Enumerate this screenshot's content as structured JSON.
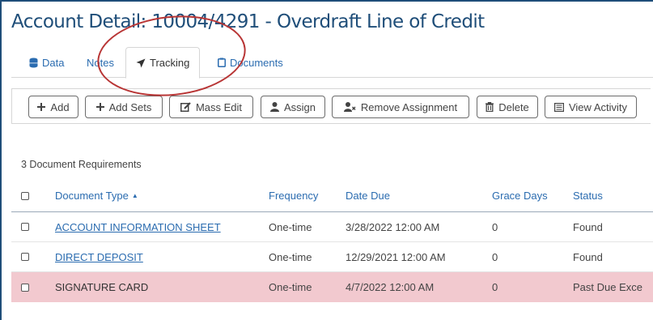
{
  "page": {
    "title": "Account Detail: 10004/4291 - Overdraft Line of Credit"
  },
  "tabs": [
    {
      "label": "Data",
      "icon": "database-icon"
    },
    {
      "label": "Notes",
      "icon": ""
    },
    {
      "label": "Tracking",
      "icon": "paper-plane-icon",
      "active": true
    },
    {
      "label": "Documents",
      "icon": "clipboard-icon"
    }
  ],
  "toolbar": {
    "buttons": [
      {
        "label": "Add",
        "icon": "plus-icon"
      },
      {
        "label": "Add Sets",
        "icon": "plus-icon"
      },
      {
        "label": "Mass Edit",
        "icon": "edit-icon"
      },
      {
        "label": "Assign",
        "icon": "user-icon"
      },
      {
        "label": "Remove Assignment",
        "icon": "user-remove-icon"
      },
      {
        "label": "Delete",
        "icon": "trash-icon"
      },
      {
        "label": "View Activity",
        "icon": "list-icon"
      }
    ]
  },
  "requirements": {
    "count_label": "3 Document Requirements",
    "columns": [
      "Document Type",
      "Frequency",
      "Date Due",
      "Grace Days",
      "Status"
    ],
    "sort_indicator": "▲",
    "rows": [
      {
        "document_type": "ACCOUNT INFORMATION SHEET",
        "frequency": "One-time",
        "date_due": "3/28/2022 12:00 AM",
        "grace_days": "0",
        "status": "Found",
        "link": true
      },
      {
        "document_type": "DIRECT DEPOSIT",
        "frequency": "One-time",
        "date_due": "12/29/2021 12:00 AM",
        "grace_days": "0",
        "status": "Found",
        "link": true
      },
      {
        "document_type": "SIGNATURE CARD",
        "frequency": "One-time",
        "date_due": "4/7/2022 12:00 AM",
        "grace_days": "0",
        "status": "Past Due Exce",
        "link": false,
        "past_due": true
      }
    ]
  },
  "colors": {
    "title": "#1f4e79",
    "link": "#2b6cb0",
    "past_due_row": "#f2c9cf",
    "annotation_circle": "#b83535"
  }
}
